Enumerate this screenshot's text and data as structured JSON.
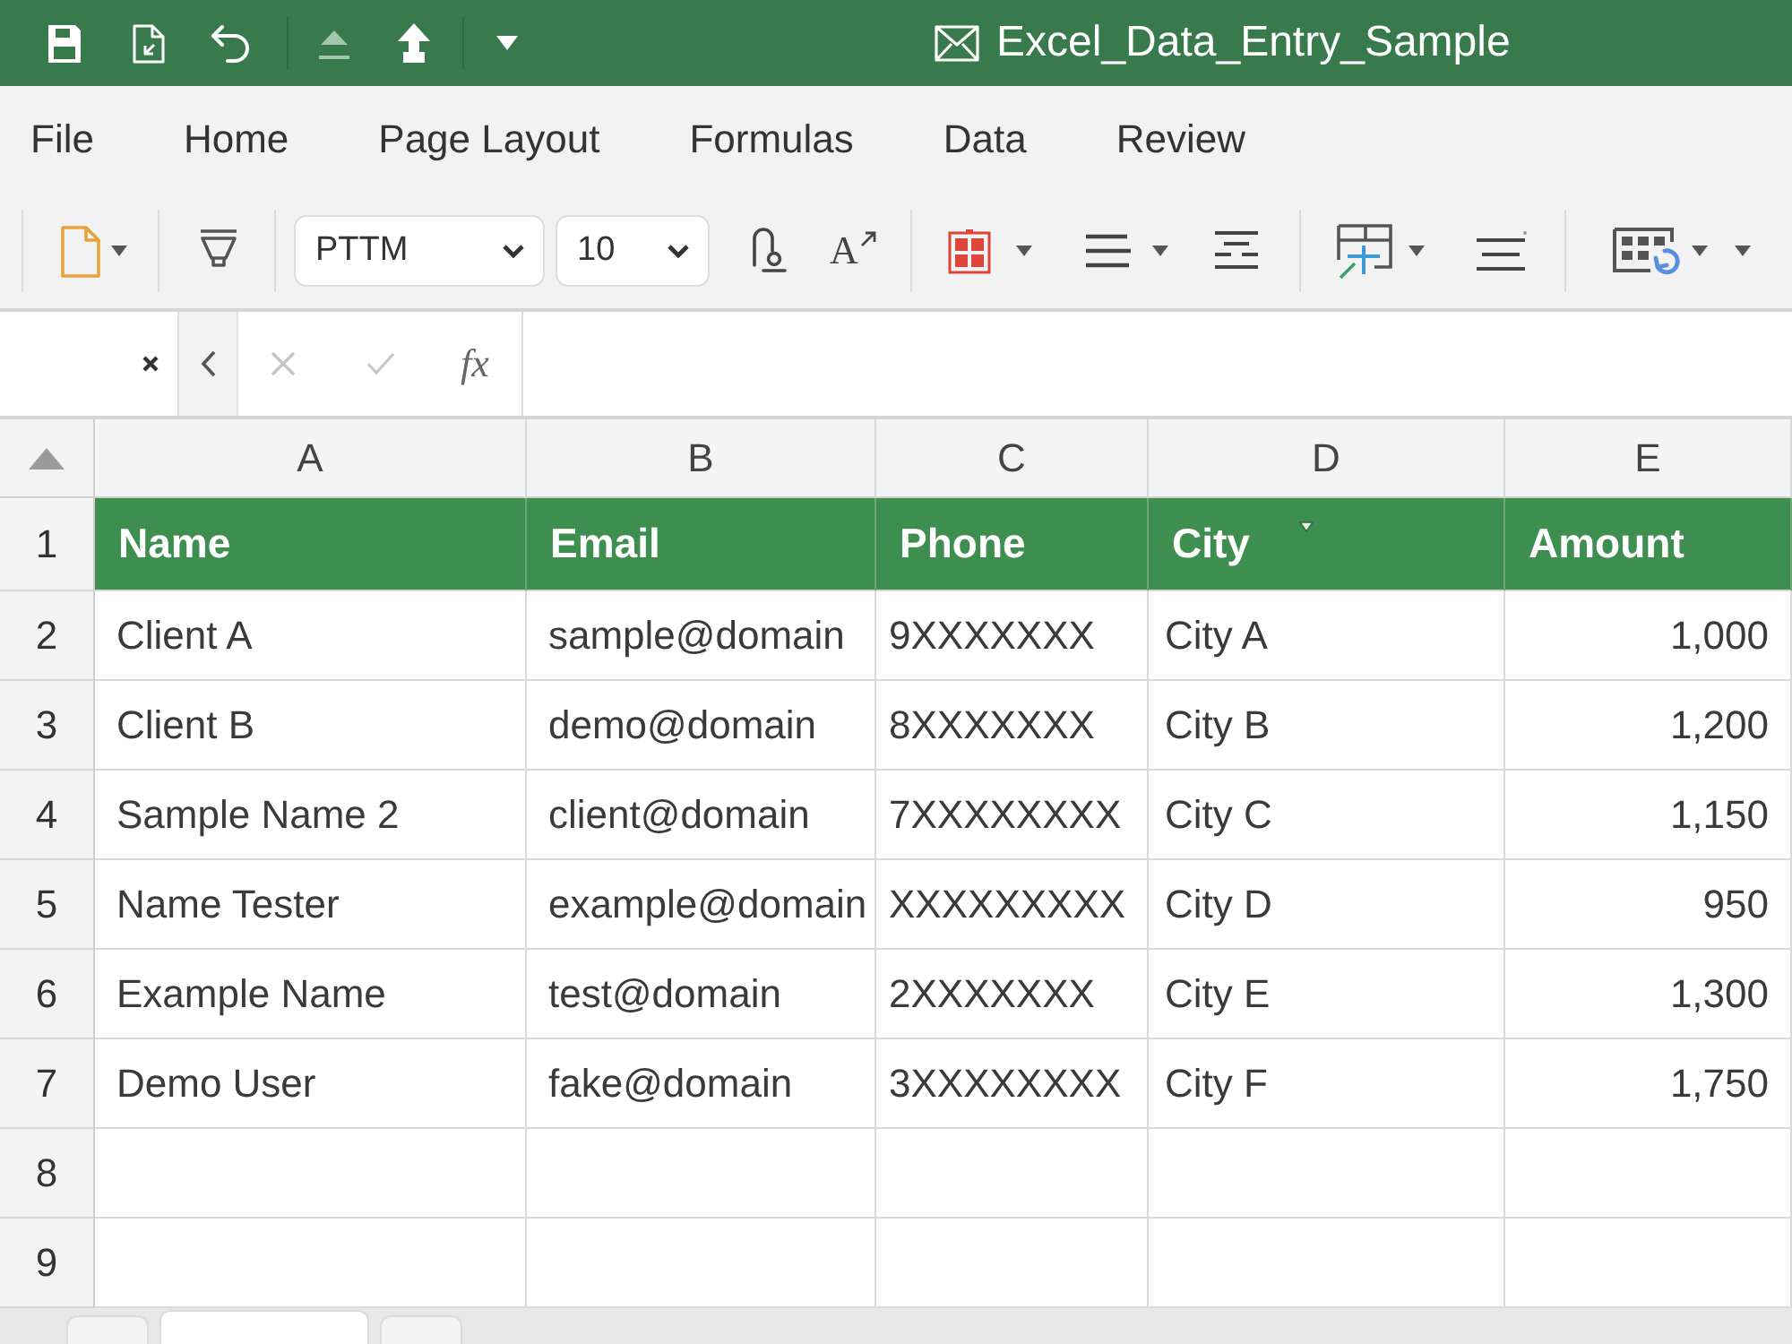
{
  "title_bar": {
    "title": "Excel_Data_Entry_Sample"
  },
  "menu_bar": [
    "File",
    "Home",
    "Page Layout",
    "Formulas",
    "Data",
    "Review"
  ],
  "toolbar": {
    "font": "PTTM",
    "font_size": "10",
    "grow_font_button": "A"
  },
  "formula_bar": {
    "function_button": "fx"
  },
  "sheet": {
    "columns": [
      {
        "letter": "A",
        "header": "Name",
        "kind": "text",
        "filter": false
      },
      {
        "letter": "B",
        "header": "Email",
        "kind": "text",
        "filter": false
      },
      {
        "letter": "C",
        "header": "Phone",
        "kind": "text",
        "filter": false
      },
      {
        "letter": "D",
        "header": "City",
        "kind": "text",
        "filter": true
      },
      {
        "letter": "E",
        "header": "Amount",
        "kind": "number",
        "filter": false
      }
    ],
    "row_numbers": [
      "1",
      "2",
      "3",
      "4",
      "5",
      "6",
      "7",
      "8",
      "9"
    ],
    "rows": [
      [
        "Client A",
        "sample@domain",
        "9XXXXXXX",
        "City A",
        "1,000"
      ],
      [
        "Client B",
        "demo@domain",
        "8XXXXXXX",
        "City B",
        "1,200"
      ],
      [
        "Sample Name 2",
        "client@domain",
        "7XXXXXXXX",
        "City C",
        "1,150"
      ],
      [
        "Name Tester",
        "example@domain",
        "XXXXXXXXX",
        "City D",
        "950"
      ],
      [
        "Example Name",
        "test@domain",
        "2XXXXXXX",
        "City E",
        "1,300"
      ],
      [
        "Demo User",
        "fake@domain",
        "3XXXXXXXX",
        "City F",
        "1,750"
      ]
    ]
  },
  "sheet_tabs": [
    {
      "selected": false
    },
    {
      "selected": true
    },
    {
      "selected": false
    }
  ]
}
